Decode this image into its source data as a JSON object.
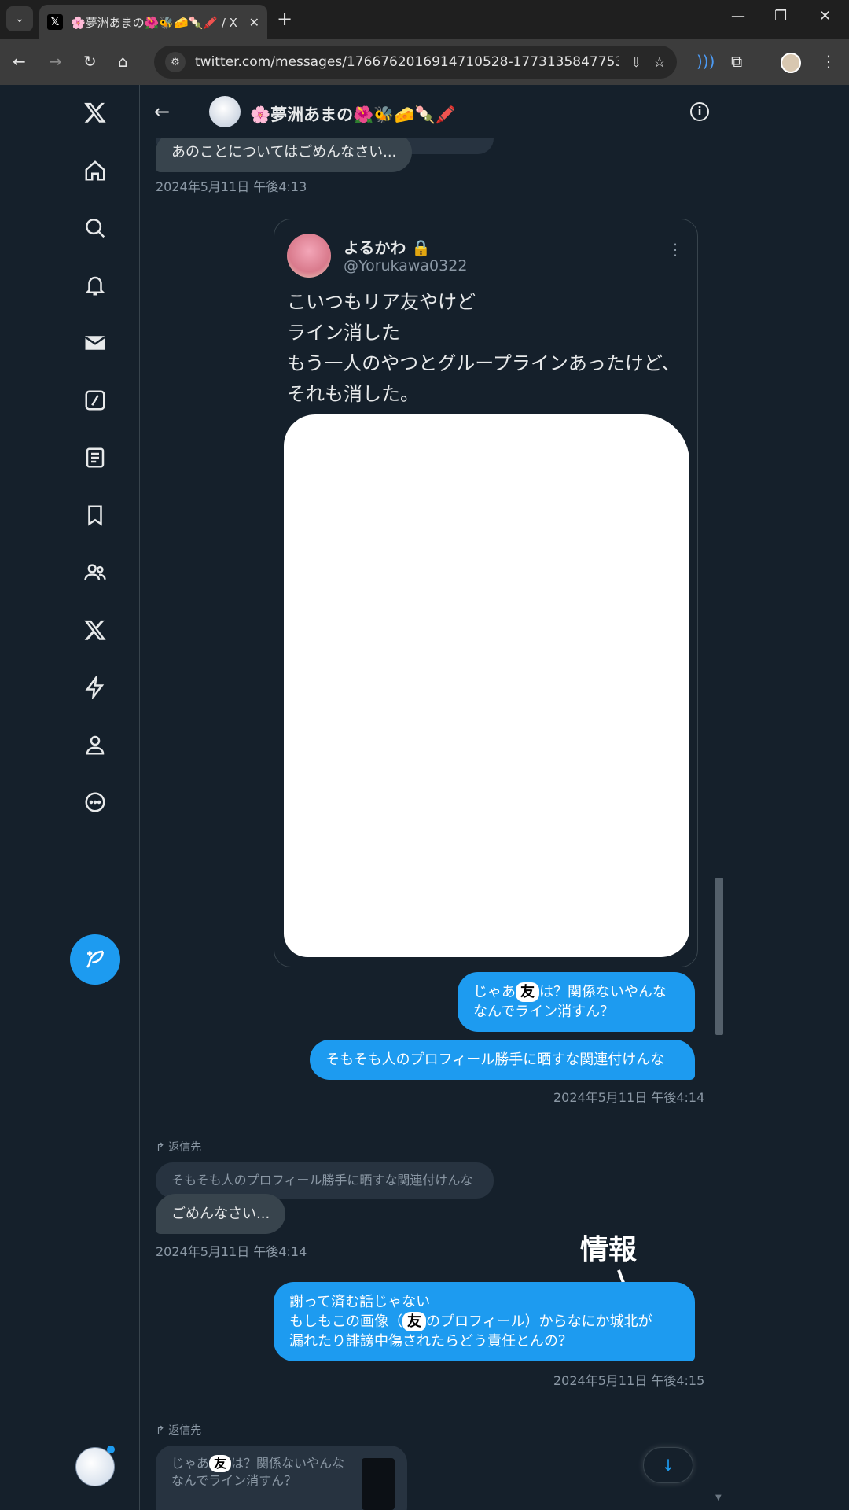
{
  "browser": {
    "tab_title": "🌸夢洲あまの🌺🐝🧀🍡🖍️ / X",
    "url": "twitter.com/messages/1766762016914710528-1773135847753461...",
    "new_tab_label": "+",
    "close_tab": "✕"
  },
  "conversation": {
    "name": "🌸夢洲あまの🌺🐝🧀🍡🖍️",
    "messages": {
      "m1_text": "あのことについてはごめんなさい...",
      "m1_time": "2024年5月11日 午後4:13",
      "m2_prefix": "じゃあ",
      "m2_redacted": "友",
      "m2_suffix": "は？関係ないやんな\nなんでライン消すん？",
      "m3_text": "そもそも人のプロフィール勝手に晒すな関連付けんな",
      "m3_time": "2024年5月11日 午後4:14",
      "reply1_label": "返信先",
      "reply1_quote": "そもそも人のプロフィール勝手に晒すな関連付けんな",
      "m4_text": "ごめんなさい...",
      "m4_time": "2024年5月11日 午後4:14",
      "m5_line1": "謝って済む話じゃない",
      "m5_line2_prefix": "もしもこの画像（",
      "m5_line2_redacted": "友",
      "m5_line2_suffix": "のプロフィール）からなにか城北が",
      "m5_line3": "漏れたり誹謗中傷されたらどう責任とんの？",
      "m5_time": "2024年5月11日 午後4:15",
      "reply2_label": "返信先",
      "reply2_prefix": "じゃあ",
      "reply2_redacted": "友",
      "reply2_suffix": "は？関係ないやんな\nなんでライン消すん？"
    },
    "quoted_tweet": {
      "name": "よるかわ",
      "handle": "@Yorukawa0322",
      "text": "こいつもリア友やけど\nライン消した\nもう一人のやつとグループラインあったけど、それも消した。"
    },
    "annotation": "情報"
  },
  "colors": {
    "background": "#15202b",
    "accent": "#1d9bf0",
    "incoming_bubble": "#38444d",
    "secondary_text": "#8b98a5"
  }
}
